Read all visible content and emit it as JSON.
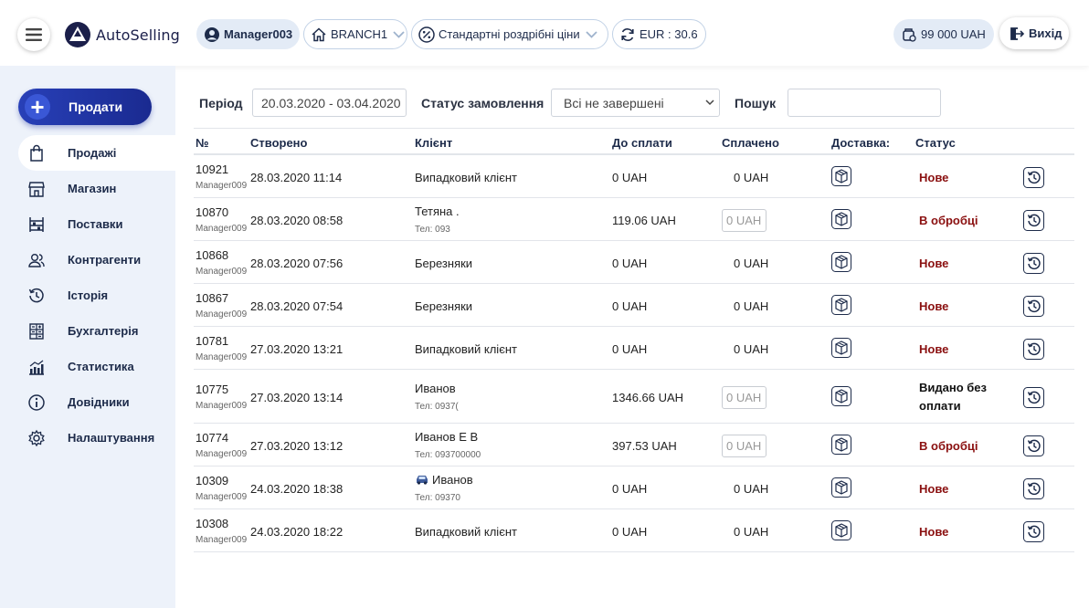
{
  "header": {
    "app_name": "AutoSelling",
    "user": "Manager003",
    "branch": "BRANCH1",
    "price_type": "Стандартні роздрібні ціни",
    "currency_rate": "EUR : 30.6",
    "balance": "99 000 UAH",
    "exit_label": "Вихід",
    "icons": [
      "menu-icon",
      "user-icon",
      "home-icon",
      "percent-icon",
      "refresh-icon",
      "wallet-icon",
      "logout-icon"
    ]
  },
  "sidebar": {
    "sell_label": "Продати",
    "items": [
      {
        "label": "Продажі",
        "icon": "bag-icon",
        "active": true
      },
      {
        "label": "Магазин",
        "icon": "store-icon"
      },
      {
        "label": "Поставки",
        "icon": "shelves-icon"
      },
      {
        "label": "Контрагенти",
        "icon": "users-icon"
      },
      {
        "label": "Історія",
        "icon": "history-icon"
      },
      {
        "label": "Бухгалтерія",
        "icon": "calculator-icon"
      },
      {
        "label": "Статистика",
        "icon": "chart-icon"
      },
      {
        "label": "Довідники",
        "icon": "info-icon"
      },
      {
        "label": "Налаштування",
        "icon": "gear-icon"
      }
    ]
  },
  "filters": {
    "period_label": "Період",
    "period_value": "20.03.2020 - 03.04.2020",
    "status_label": "Статус замовлення",
    "status_value": "Всі не завершені",
    "search_label": "Пошук",
    "search_value": ""
  },
  "table": {
    "columns": [
      "№",
      "Створено",
      "Клієнт",
      "До сплати",
      "Сплачено",
      "Доставка:",
      "Статус"
    ],
    "rows": [
      {
        "id": "10921",
        "manager": "Manager009",
        "created": "28.03.2020 11:14",
        "client": "Випадковий клієнт",
        "phone": "",
        "to_pay": "0 UAH",
        "paid": "0 UAH",
        "paid_input": false,
        "status": "Нове"
      },
      {
        "id": "10870",
        "manager": "Manager009",
        "created": "28.03.2020 08:58",
        "client": "Тетяна .",
        "phone": "Тел: 093",
        "to_pay": "119.06 UAH",
        "paid": "0 UAH",
        "paid_input": true,
        "status": "В обробці"
      },
      {
        "id": "10868",
        "manager": "Manager009",
        "created": "28.03.2020 07:56",
        "client": "Березняки",
        "phone": "",
        "to_pay": "0 UAH",
        "paid": "0 UAH",
        "paid_input": false,
        "status": "Нове"
      },
      {
        "id": "10867",
        "manager": "Manager009",
        "created": "28.03.2020 07:54",
        "client": "Березняки",
        "phone": "",
        "to_pay": "0 UAH",
        "paid": "0 UAH",
        "paid_input": false,
        "status": "Нове"
      },
      {
        "id": "10781",
        "manager": "Manager009",
        "created": "27.03.2020 13:21",
        "client": "Випадковий клієнт",
        "phone": "",
        "to_pay": "0 UAH",
        "paid": "0 UAH",
        "paid_input": false,
        "status": "Нове"
      },
      {
        "id": "10775",
        "manager": "Manager009",
        "created": "27.03.2020 13:14",
        "client": "Иванов",
        "phone": "Тел: 0937(",
        "to_pay": "1346.66 UAH",
        "paid": "0 UAH",
        "paid_input": true,
        "status_line1": "Видано без",
        "status_line2": "оплати"
      },
      {
        "id": "10774",
        "manager": "Manager009",
        "created": "27.03.2020 13:12",
        "client": "Иванов Е В",
        "phone": "Тел: 093700000",
        "to_pay": "397.53 UAH",
        "paid": "0 UAH",
        "paid_input": true,
        "status": "В обробці"
      },
      {
        "id": "10309",
        "manager": "Manager009",
        "created": "24.03.2020 18:38",
        "client": "Иванов",
        "phone": "Тел: 09370",
        "to_pay": "0 UAH",
        "paid": "0 UAH",
        "paid_input": false,
        "status": "Нове",
        "client_icon": "car-icon"
      },
      {
        "id": "10308",
        "manager": "Manager009",
        "created": "24.03.2020 18:22",
        "client": "Випадковий клієнт",
        "phone": "",
        "to_pay": "0 UAH",
        "paid": "0 UAH",
        "paid_input": false,
        "status": "Нове"
      }
    ]
  },
  "colors": {
    "accent": "#2236a8",
    "sidebar_bg": "#edf2fa",
    "status_red": "#8a0f0f",
    "pill_bg": "#e3ebf6"
  }
}
